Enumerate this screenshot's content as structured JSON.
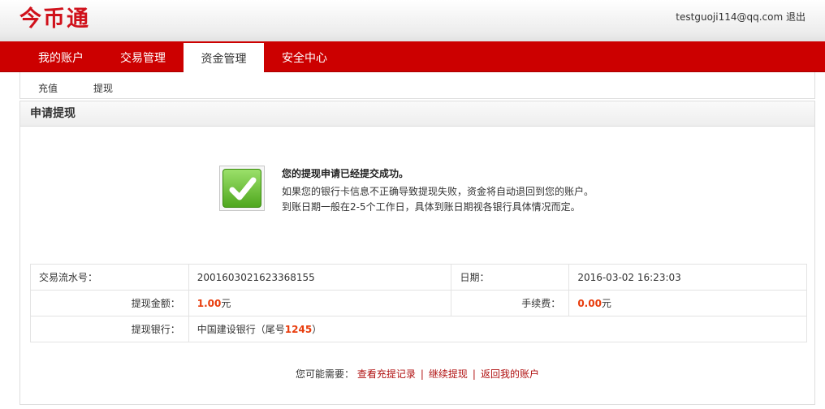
{
  "header": {
    "logo": "今币通",
    "user_email": "testguoji114@qq.com",
    "logout": "退出"
  },
  "nav": {
    "items": [
      {
        "label": "我的账户"
      },
      {
        "label": "交易管理"
      },
      {
        "label": "资金管理"
      },
      {
        "label": "安全中心"
      }
    ],
    "active": "资金管理"
  },
  "subnav": {
    "items": [
      {
        "label": "充值"
      },
      {
        "label": "提现"
      }
    ]
  },
  "panel": {
    "title": "申请提现",
    "success_title": "您的提现申请已经提交成功。",
    "success_line1": "如果您的银行卡信息不正确导致提现失败，资金将自动退回到您的账户。",
    "success_line2": "到账日期一般在2-5个工作日，具体到账日期视各银行具体情况而定。",
    "icon": "check-icon"
  },
  "details": {
    "serial_label": "交易流水号：",
    "serial_value": "2001603021623368155",
    "date_label": "日期：",
    "date_value": "2016-03-02 16:23:03",
    "amount_label": "提现金额：",
    "amount_value": "1.00",
    "amount_unit": "元",
    "fee_label": "手续费：",
    "fee_value": "0.00",
    "fee_unit": "元",
    "bank_label": "提现银行：",
    "bank_name": "中国建设银行（尾号",
    "bank_tail": "1245",
    "bank_close": "）"
  },
  "footer": {
    "prompt": "您可能需要：",
    "link1": "查看充提记录",
    "link2": "继续提现",
    "link3": "返回我的账户",
    "separator": "|"
  },
  "colors": {
    "brand_red": "#cc0000",
    "amount_orange": "#e83c0c",
    "link_red": "#b01010"
  }
}
